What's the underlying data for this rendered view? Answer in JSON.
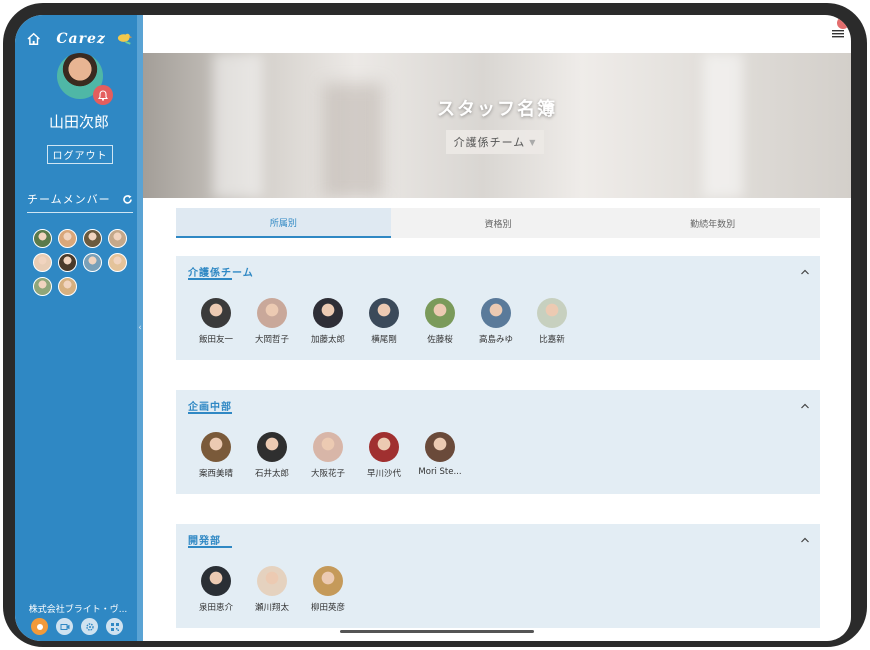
{
  "app": {
    "brand": "Carez"
  },
  "user": {
    "name": "山田次郎",
    "logout_label": "ログアウト"
  },
  "sidebar": {
    "team_members_label": "チームメンバー",
    "company": "株式会社ブライト・ヴ...",
    "member_avatar_colors": [
      "#5a7a4a",
      "#d9a77a",
      "#6b5a3e",
      "#c4a88a",
      "#e8cdb5",
      "#4a3a2a",
      "#7aa0b8",
      "#e4c39a",
      "#8fa67a",
      "#d6b080"
    ]
  },
  "page": {
    "title": "スタッフ名簿",
    "team_select": "介護係チーム",
    "tabs": [
      {
        "label": "所属別",
        "active": true
      },
      {
        "label": "資格別",
        "active": false
      },
      {
        "label": "勤続年数別",
        "active": false
      }
    ]
  },
  "sections": [
    {
      "title": "介護係チーム",
      "members": [
        {
          "name": "飯田友一",
          "color": "#3a3a3a"
        },
        {
          "name": "大岡哲子",
          "color": "#c9a89a"
        },
        {
          "name": "加藤太郎",
          "color": "#2e2e36"
        },
        {
          "name": "横尾剛",
          "color": "#3b4a5a"
        },
        {
          "name": "佐藤桜",
          "color": "#7a9a5a"
        },
        {
          "name": "高島みゆ",
          "color": "#5a7a9a"
        },
        {
          "name": "比嘉新",
          "color": "#c7d0bf"
        }
      ]
    },
    {
      "title": "企画中部",
      "members": [
        {
          "name": "案西美晴",
          "color": "#7a5a3a"
        },
        {
          "name": "石井太郎",
          "color": "#2f2f2f"
        },
        {
          "name": "大阪花子",
          "color": "#d8b6a8"
        },
        {
          "name": "早川沙代",
          "color": "#a03030"
        },
        {
          "name": "Mori Ste...",
          "color": "#6a4a3a"
        }
      ]
    },
    {
      "title": "開発部",
      "members": [
        {
          "name": "泉田恵介",
          "color": "#2a2f35"
        },
        {
          "name": "瀬川翔太",
          "color": "#e5d2bf"
        },
        {
          "name": "柳田英彦",
          "color": "#c59a5a"
        }
      ]
    }
  ],
  "colors": {
    "accent": "#2f88c4",
    "section_bg": "#e3edf4",
    "notification": "#e36d6d"
  }
}
